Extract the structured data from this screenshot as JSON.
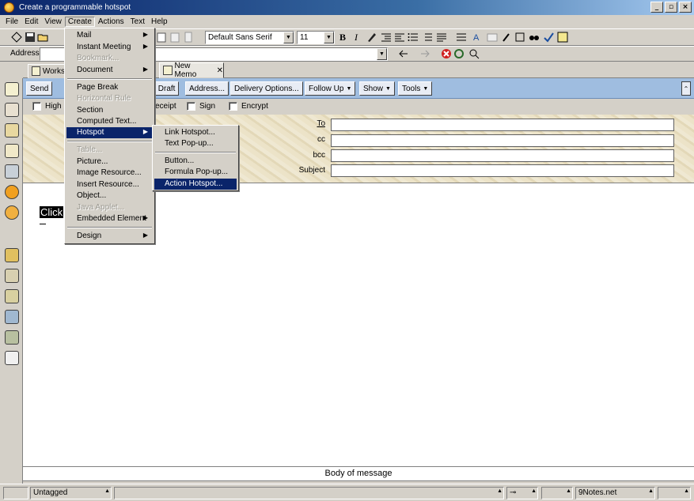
{
  "window": {
    "title": "Create a programmable hotspot",
    "minimize": "_",
    "maximize": "▫",
    "close": "×"
  },
  "menubar": [
    "File",
    "Edit",
    "View",
    "Create",
    "Actions",
    "Text",
    "Help"
  ],
  "toolbar": {
    "font": "Default Sans Serif",
    "size": "11",
    "bold": "B",
    "italic": "I"
  },
  "address": {
    "label": "Address",
    "value": ""
  },
  "tabs": [
    {
      "label": "Works"
    },
    {
      "label": "New Memo"
    }
  ],
  "action_bar": {
    "send": "Send",
    "save_draft": "s Draft",
    "address": "Address...",
    "delivery": "Delivery Options...",
    "follow_up": "Follow Up",
    "show": "Show",
    "tools": "Tools"
  },
  "options": {
    "high": "High",
    "receipt": "eceipt",
    "sign": "Sign",
    "encrypt": "Encrypt"
  },
  "header": {
    "to": "To",
    "cc": "cc",
    "bcc": "bcc",
    "subject": "Subject"
  },
  "body": {
    "selected_text": "Click",
    "footer_label": "Body of message"
  },
  "status": {
    "tag": "Untagged",
    "location": "9Notes.net"
  },
  "create_menu": {
    "items": [
      {
        "label": "Mail",
        "disabled": false,
        "submenu": true
      },
      {
        "label": "Instant Meeting",
        "disabled": false,
        "submenu": true
      },
      {
        "label": "Bookmark...",
        "disabled": true,
        "submenu": false
      },
      {
        "label": "Document",
        "disabled": false,
        "submenu": true
      },
      {
        "label": "Page Break",
        "disabled": false,
        "submenu": false
      },
      {
        "label": "Horizontal Rule",
        "disabled": true,
        "submenu": false
      },
      {
        "label": "Section",
        "disabled": false,
        "submenu": false
      },
      {
        "label": "Computed Text...",
        "disabled": false,
        "submenu": false
      },
      {
        "label": "Hotspot",
        "disabled": false,
        "submenu": true,
        "selected": true
      },
      {
        "label": "Table...",
        "disabled": true,
        "submenu": false
      },
      {
        "label": "Picture...",
        "disabled": false,
        "submenu": false
      },
      {
        "label": "Image Resource...",
        "disabled": false,
        "submenu": false
      },
      {
        "label": "Insert Resource...",
        "disabled": false,
        "submenu": false
      },
      {
        "label": "Object...",
        "disabled": false,
        "submenu": false
      },
      {
        "label": "Java Applet...",
        "disabled": true,
        "submenu": false
      },
      {
        "label": "Embedded Element",
        "disabled": false,
        "submenu": true
      },
      {
        "label": "Design",
        "disabled": false,
        "submenu": true
      }
    ]
  },
  "hotspot_menu": {
    "items": [
      {
        "label": "Link Hotspot..."
      },
      {
        "label": "Text Pop-up..."
      },
      {
        "label": "Button..."
      },
      {
        "label": "Formula Pop-up..."
      },
      {
        "label": "Action Hotspot...",
        "selected": true
      }
    ]
  }
}
